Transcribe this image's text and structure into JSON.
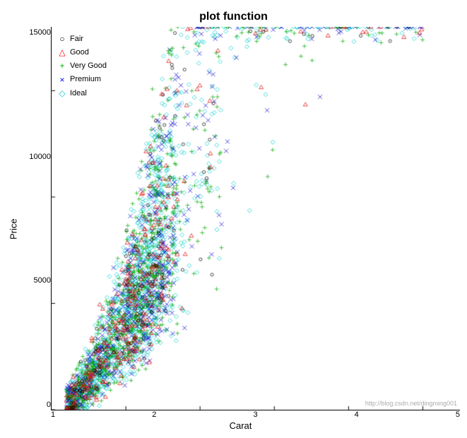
{
  "title": "plot function",
  "yAxisLabel": "Price",
  "xAxisLabel": "Carat",
  "yTicks": [
    "15000",
    "10000",
    "5000",
    "0"
  ],
  "xTicks": [
    "1",
    "2",
    "3",
    "4",
    "5"
  ],
  "legend": [
    {
      "label": "Fair",
      "symbol": "○",
      "color": "#000000"
    },
    {
      "label": "Good",
      "symbol": "△",
      "color": "#ff0000"
    },
    {
      "label": "Very Good",
      "symbol": "+",
      "color": "#00aa00"
    },
    {
      "label": "Premium",
      "symbol": "×",
      "color": "#0000ff"
    },
    {
      "label": "Ideal",
      "symbol": "◇",
      "color": "#00cccc"
    }
  ],
  "watermark": "http://blog.csdn.net/dingming001"
}
